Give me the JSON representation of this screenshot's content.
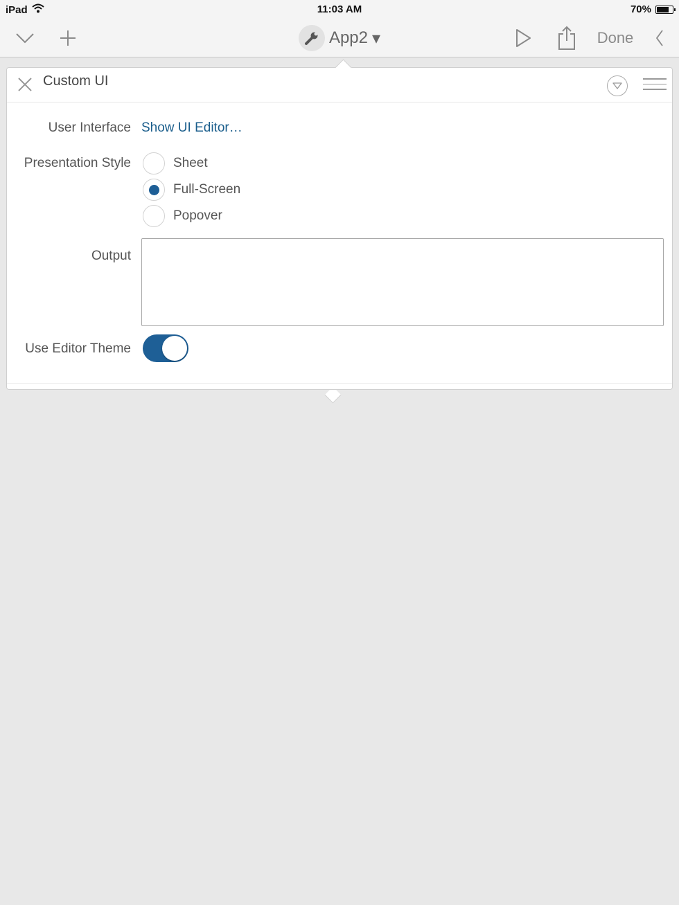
{
  "status_bar": {
    "device": "iPad",
    "time": "11:03 AM",
    "battery": "70%"
  },
  "toolbar": {
    "app_title": "App2",
    "title_caret": "▾",
    "done_label": "Done"
  },
  "panel": {
    "title": "Custom UI",
    "user_interface": {
      "label": "User Interface",
      "link": "Show UI Editor…"
    },
    "presentation_style": {
      "label": "Presentation Style",
      "options": [
        "Sheet",
        "Full-Screen",
        "Popover"
      ],
      "selected": "Full-Screen"
    },
    "output": {
      "label": "Output",
      "value": ""
    },
    "use_editor_theme": {
      "label": "Use Editor Theme",
      "on": true
    }
  },
  "colors": {
    "accent": "#1e5f96",
    "link": "#1b5e8c",
    "background": "#e8e8e8"
  },
  "icons": [
    "wifi-icon",
    "battery-icon",
    "chevron-down-icon",
    "plus-icon",
    "wrench-icon",
    "play-icon",
    "share-icon",
    "chevron-left-icon",
    "close-icon",
    "collapse-icon",
    "hamburger-icon"
  ]
}
